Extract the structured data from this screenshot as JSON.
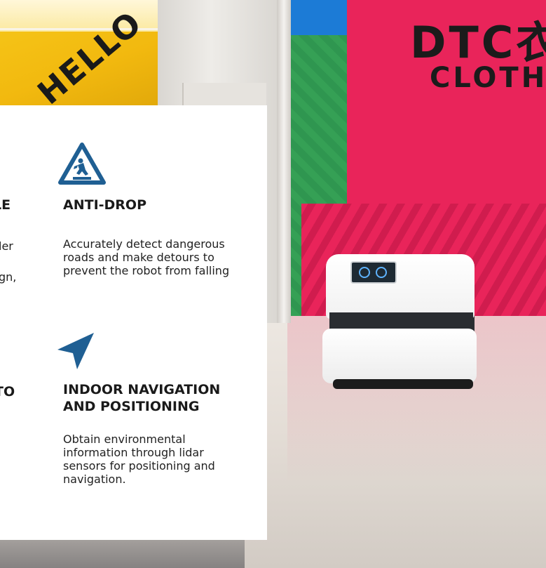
{
  "scene": {
    "store_sign_left": "HELLO",
    "store_sign_right_line1": "DTC衣",
    "store_sign_right_line2": "CLOTHE"
  },
  "features": {
    "left_column": [
      {
        "heading": "LE",
        "description_lines": [
          "ler",
          "",
          "gn,"
        ]
      },
      {
        "heading": "TO",
        "description_lines": []
      }
    ],
    "right_column": [
      {
        "icon": "anti-drop-warning-icon",
        "heading": "ANTI-DROP",
        "description": "Accurately detect dangerous roads and make detours to prevent the robot from falling"
      },
      {
        "icon": "navigation-arrow-icon",
        "heading_line1": "INDOOR NAVIGATION",
        "heading_line2": "AND POSITIONING",
        "description": "Obtain environmental information through lidar sensors for positioning and navigation."
      }
    ]
  },
  "colors": {
    "icon_blue": "#1f5f93",
    "card_background": "#ffffff",
    "text": "#1a1a1a",
    "pink_wall": "#e9245a",
    "yellow_store": "#f6c81a"
  }
}
